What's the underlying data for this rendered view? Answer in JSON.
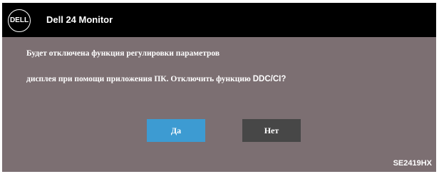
{
  "header": {
    "logo_text": "DELL",
    "title": "Dell 24 Monitor"
  },
  "dialog": {
    "line1": "Будет отключена функция регулировки параметров",
    "line2_prefix": "дисплея при помощи приложения ПК. Отключить функцию ",
    "line2_emphasis": "DDC/CI?"
  },
  "buttons": {
    "yes_label": "Да",
    "no_label": "Нет"
  },
  "footer": {
    "model": "SE2419HX"
  },
  "colors": {
    "panel_bg": "#7c6f72",
    "title_bar_bg": "#000000",
    "yes_button": "#3d9bd2",
    "no_button": "#474747",
    "text": "#ffffff"
  }
}
